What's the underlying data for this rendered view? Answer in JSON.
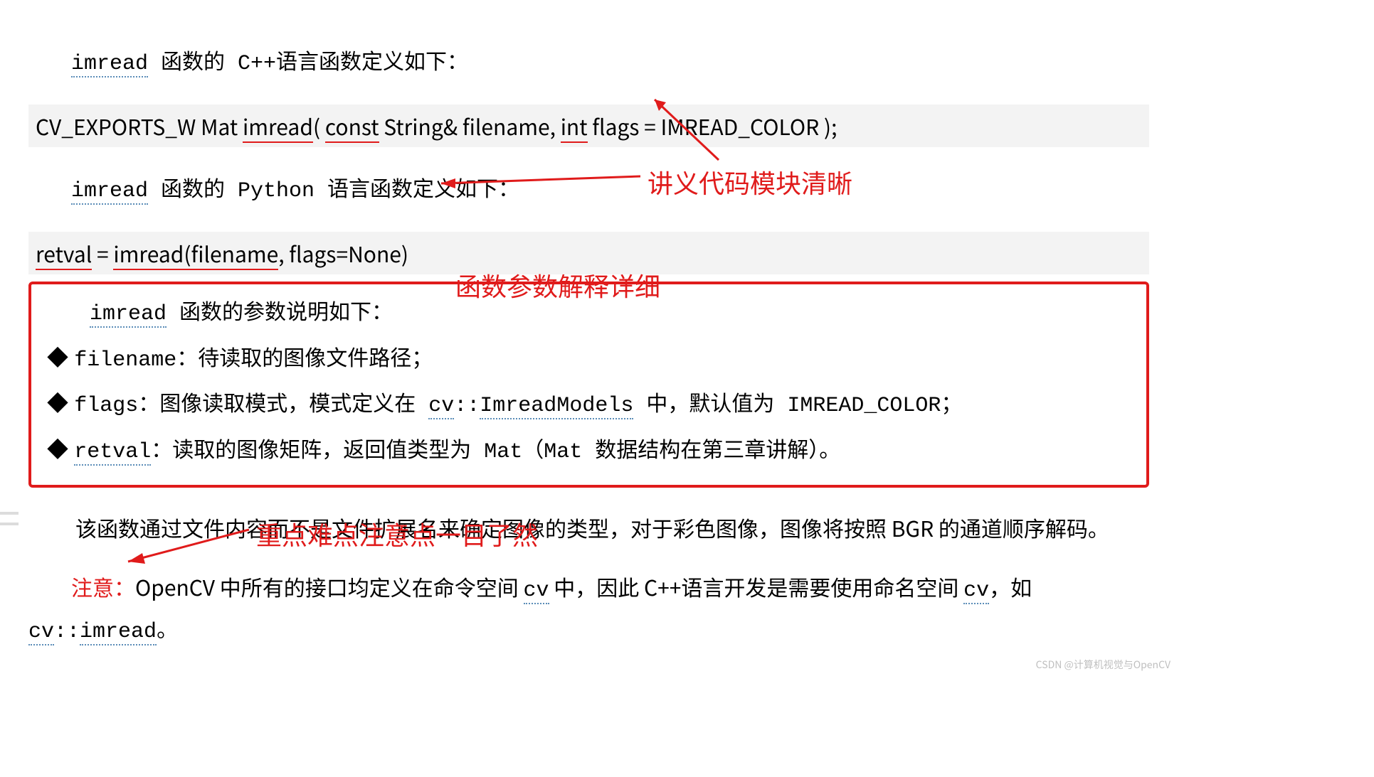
{
  "lines": {
    "cpp_def_intro": "imread 函数的 C++语言函数定义如下：",
    "cpp_sig_pre": "CV_EXPORTS_W Mat ",
    "cpp_sig_u1": "imread",
    "cpp_sig_mid1": "( ",
    "cpp_sig_u2": "const",
    "cpp_sig_mid2": " String& filename, ",
    "cpp_sig_u3": "int",
    "cpp_sig_mid3": " flags = IMREAD_COLOR );",
    "py_def_intro": "imread 函数的 Python 语言函数定义如下：",
    "py_sig_u1": "retval",
    "py_sig_mid1": " = ",
    "py_sig_u2": "imread(filename",
    "py_sig_mid2": ", flags=None)",
    "params_intro": "imread 函数的参数说明如下：",
    "bullet": "◆",
    "p1_pre": "filename：待读取的图像文件路径；",
    "p2_pre": "flags：图像读取模式，模式定义在 ",
    "p2_u1": "cv",
    "p2_cc": "::",
    "p2_u2": "ImreadModels",
    "p2_post": " 中，默认值为 IMREAD_COLOR；",
    "p3_u1": "retval",
    "p3_post": "：读取的图像矩阵，返回值类型为 Mat（Mat 数据结构在第三章讲解）。",
    "reading_line": "该函数通过文件内容而不是文件扩展名来确定图像的类型，对于彩色图像，图像将按照 BGR 的通道顺序解码。",
    "note_label": "注意：",
    "note_text_1": "OpenCV 中所有的接口均定义在命令空间 ",
    "note_u1": "cv",
    "note_text_2": " 中，因此 C++语言开发是需要使用命名空间 ",
    "note_u2": "cv",
    "note_text_3": "，如 ",
    "note_u3": "cv",
    "note_cc": "::",
    "note_u4": "imread",
    "note_text_4": "。"
  },
  "annotations": {
    "a1": "讲义代码模块清晰",
    "a2": "函数参数解释详细",
    "a3": "重点难点注意点一目了然"
  },
  "watermark": "CSDN @计算机视觉与OpenCV"
}
